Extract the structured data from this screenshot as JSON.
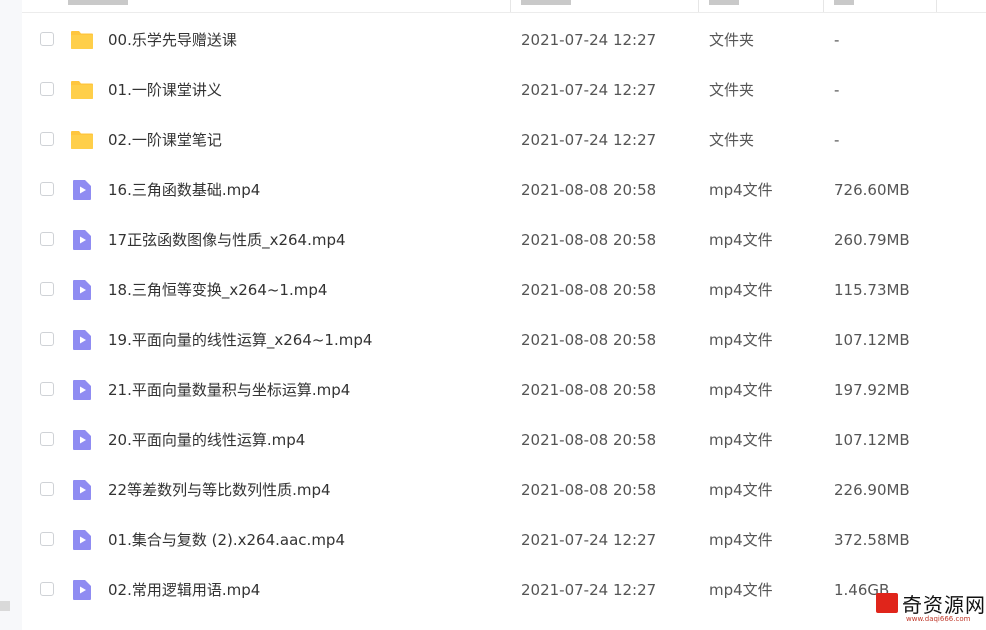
{
  "files": [
    {
      "name": "00.乐学先导赠送课",
      "date": "2021-07-24 12:27",
      "type": "文件夹",
      "size": "-",
      "icon": "folder-icon"
    },
    {
      "name": "01.一阶课堂讲义",
      "date": "2021-07-24 12:27",
      "type": "文件夹",
      "size": "-",
      "icon": "folder-icon"
    },
    {
      "name": "02.一阶课堂笔记",
      "date": "2021-07-24 12:27",
      "type": "文件夹",
      "size": "-",
      "icon": "folder-icon"
    },
    {
      "name": "16.三角函数基础.mp4",
      "date": "2021-08-08 20:58",
      "type": "mp4文件",
      "size": "726.60MB",
      "icon": "video-file-icon"
    },
    {
      "name": "17正弦函数图像与性质_x264.mp4",
      "date": "2021-08-08 20:58",
      "type": "mp4文件",
      "size": "260.79MB",
      "icon": "video-file-icon"
    },
    {
      "name": "18.三角恒等变换_x264~1.mp4",
      "date": "2021-08-08 20:58",
      "type": "mp4文件",
      "size": "115.73MB",
      "icon": "video-file-icon"
    },
    {
      "name": "19.平面向量的线性运算_x264~1.mp4",
      "date": "2021-08-08 20:58",
      "type": "mp4文件",
      "size": "107.12MB",
      "icon": "video-file-icon"
    },
    {
      "name": "21.平面向量数量积与坐标运算.mp4",
      "date": "2021-08-08 20:58",
      "type": "mp4文件",
      "size": "197.92MB",
      "icon": "video-file-icon"
    },
    {
      "name": "20.平面向量的线性运算.mp4",
      "date": "2021-08-08 20:58",
      "type": "mp4文件",
      "size": "107.12MB",
      "icon": "video-file-icon"
    },
    {
      "name": "22等差数列与等比数列性质.mp4",
      "date": "2021-08-08 20:58",
      "type": "mp4文件",
      "size": "226.90MB",
      "icon": "video-file-icon"
    },
    {
      "name": "01.集合与复数 (2).x264.aac.mp4",
      "date": "2021-07-24 12:27",
      "type": "mp4文件",
      "size": "372.58MB",
      "icon": "video-file-icon"
    },
    {
      "name": "02.常用逻辑用语.mp4",
      "date": "2021-07-24 12:27",
      "type": "mp4文件",
      "size": "1.46GB",
      "icon": "video-file-icon"
    }
  ],
  "colors": {
    "folder": "#ffc63d",
    "video_icon": "#8f8cf2",
    "text": "#333333",
    "muted": "#555555"
  },
  "watermark": {
    "text": "奇资源网",
    "url": "www.daqi666.com"
  }
}
